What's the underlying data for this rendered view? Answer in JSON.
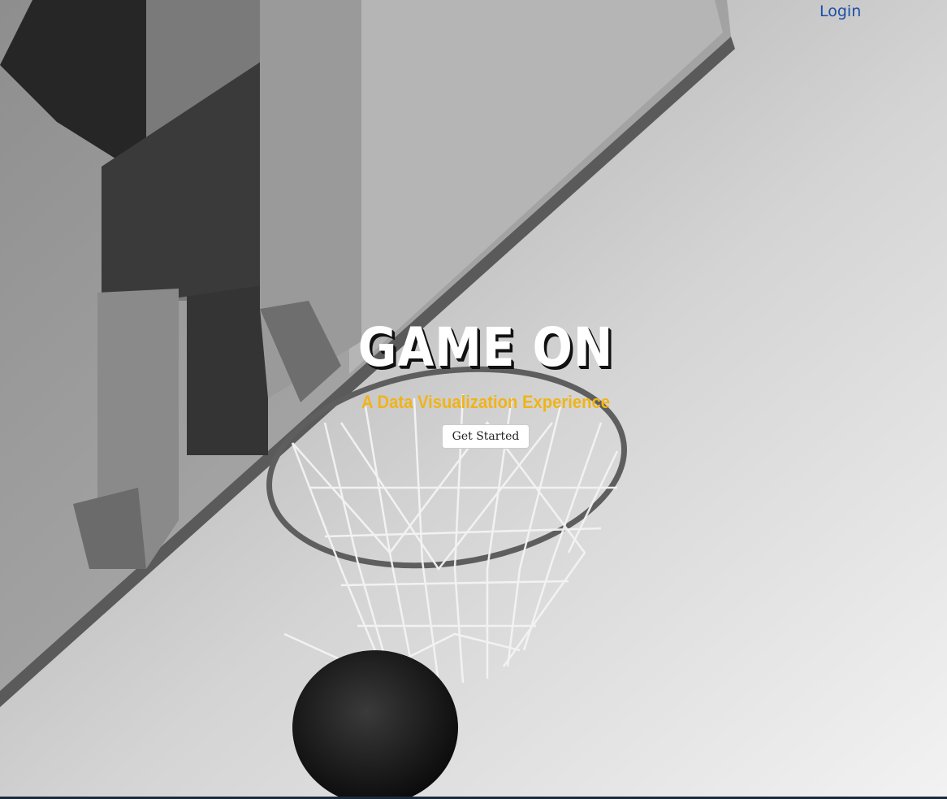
{
  "nav": {
    "login_label": "Login"
  },
  "hero": {
    "title": "GAME ON",
    "subtitle": "A Data Visualization Experience",
    "cta_label": "Get Started",
    "background_image": "basketball-hoop-photo"
  },
  "colors": {
    "link": "#1a4fa8",
    "subtitle": "#f0b419",
    "title": "#ffffff",
    "title_shadow": "#111111"
  }
}
